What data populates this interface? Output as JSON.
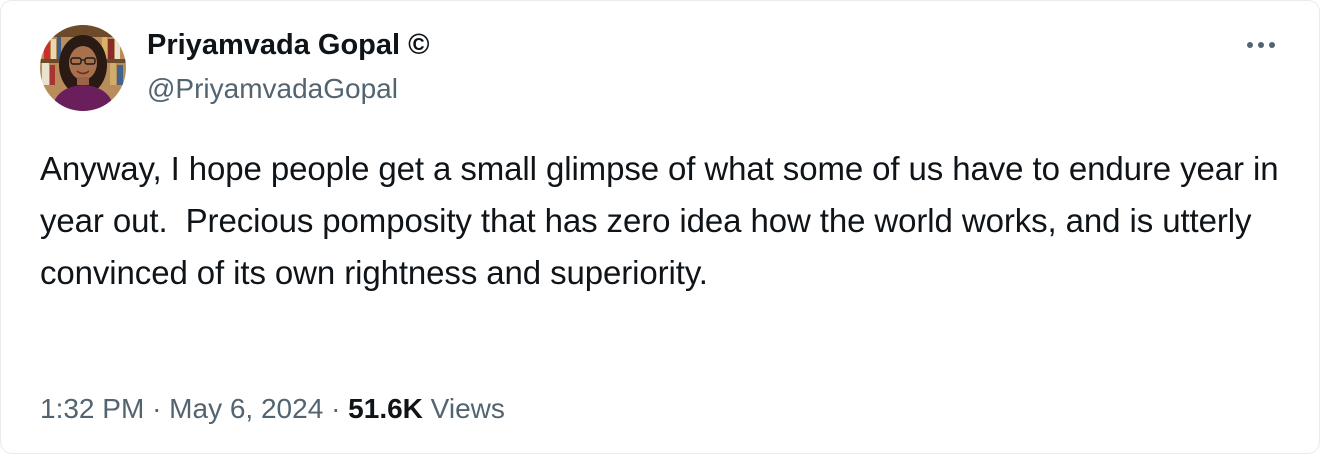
{
  "author": {
    "display_name": "Priyamvada Gopal ©",
    "handle": "@PriyamvadaGopal"
  },
  "tweet": {
    "text": "Anyway, I hope people get a small glimpse of what some of us have to endure year in year out.  Precious pomposity that has zero idea how the world works, and is utterly convinced of its own rightness and superiority.",
    "time": "1:32 PM",
    "separator": "·",
    "date": "May 6, 2024",
    "views_count": "51.6K",
    "views_label": "Views"
  },
  "icons": {
    "more": "more-horizontal-icon",
    "avatar": "profile-photo"
  },
  "colors": {
    "text_primary": "#0f1419",
    "text_secondary": "#536471",
    "background": "#ffffff"
  }
}
